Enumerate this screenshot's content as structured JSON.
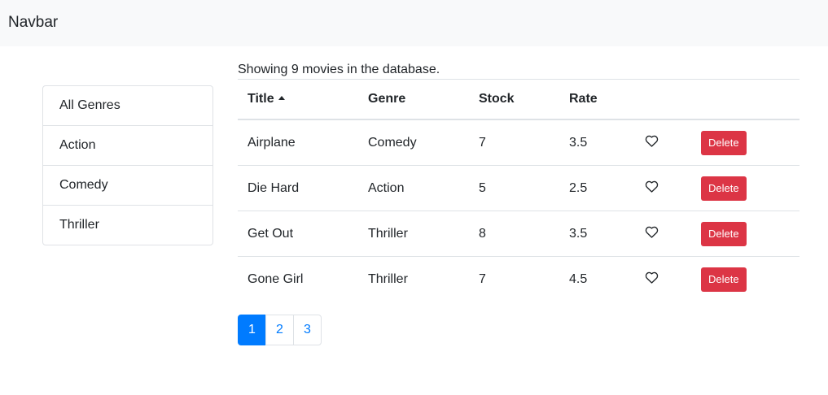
{
  "navbar": {
    "brand": "Navbar"
  },
  "sidebar": {
    "items": [
      {
        "label": "All Genres"
      },
      {
        "label": "Action"
      },
      {
        "label": "Comedy"
      },
      {
        "label": "Thriller"
      }
    ]
  },
  "summary": "Showing 9 movies in the database.",
  "table": {
    "headers": [
      "Title",
      "Genre",
      "Stock",
      "Rate",
      "",
      ""
    ],
    "sort_indicator": "ascending",
    "rows": [
      {
        "title": "Airplane",
        "genre": "Comedy",
        "stock": "7",
        "rate": "3.5",
        "liked": false,
        "delete_label": "Delete"
      },
      {
        "title": "Die Hard",
        "genre": "Action",
        "stock": "5",
        "rate": "2.5",
        "liked": false,
        "delete_label": "Delete"
      },
      {
        "title": "Get Out",
        "genre": "Thriller",
        "stock": "8",
        "rate": "3.5",
        "liked": false,
        "delete_label": "Delete"
      },
      {
        "title": "Gone Girl",
        "genre": "Thriller",
        "stock": "7",
        "rate": "4.5",
        "liked": false,
        "delete_label": "Delete"
      }
    ]
  },
  "pagination": {
    "pages": [
      "1",
      "2",
      "3"
    ],
    "current": "1"
  },
  "colors": {
    "primary": "#007bff",
    "danger": "#dc3545",
    "navbar_bg": "#f8f9fa"
  },
  "icons": {
    "like": "heart-outline-icon",
    "sort": "caret-up-icon"
  }
}
